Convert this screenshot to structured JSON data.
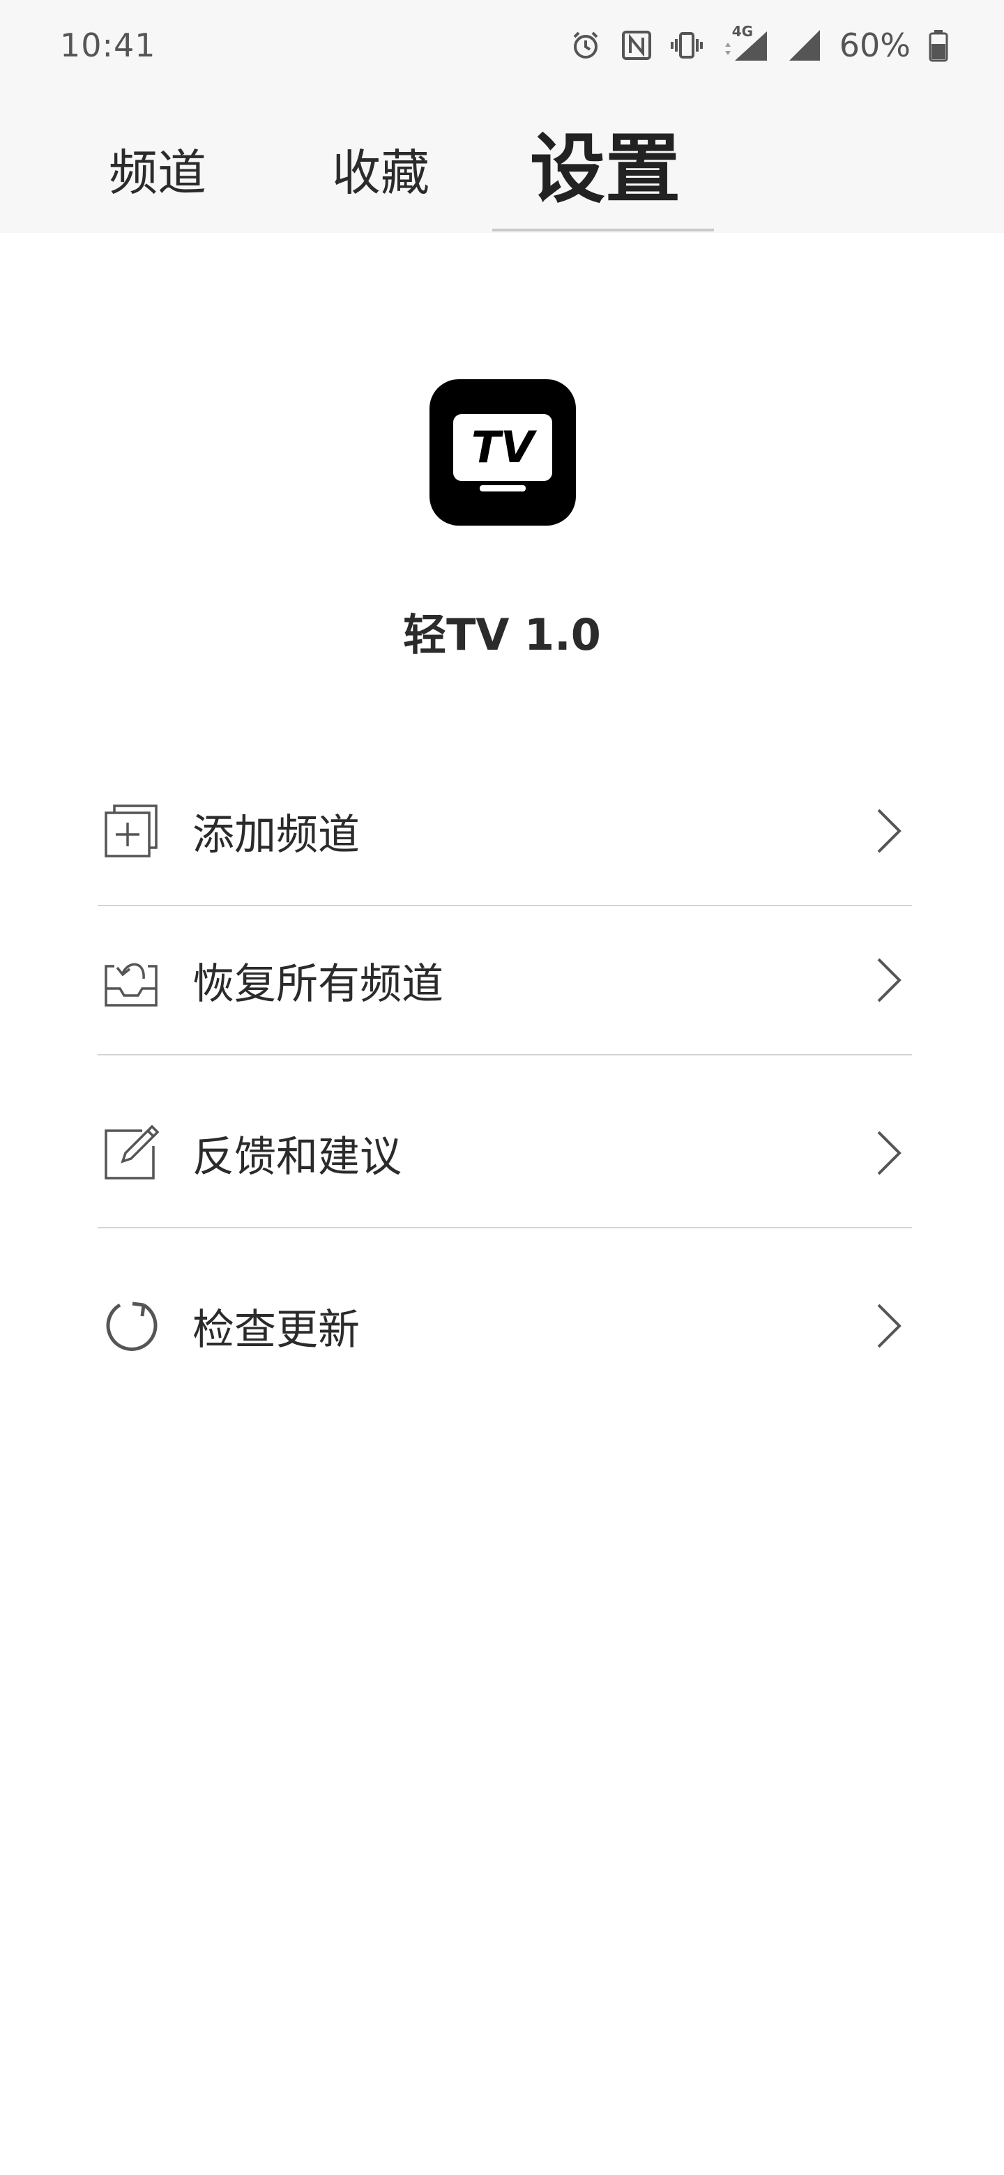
{
  "status_bar": {
    "time": "10:41",
    "network": "4G",
    "battery_percent": "60%",
    "icons": [
      "alarm-icon",
      "nfc-icon",
      "vibrate-icon",
      "data-arrows-icon",
      "signal-icon",
      "signal-icon",
      "battery-icon"
    ]
  },
  "tabs": [
    {
      "label": "频道",
      "active": false
    },
    {
      "label": "收藏",
      "active": false
    },
    {
      "label": "设置",
      "active": true
    }
  ],
  "app": {
    "logo_text": "TV",
    "name": "轻TV 1.0"
  },
  "menu": [
    {
      "label": "添加频道",
      "icon": "add-channel-icon"
    },
    {
      "label": "恢复所有频道",
      "icon": "restore-inbox-icon"
    },
    {
      "label": "反馈和建议",
      "icon": "edit-feedback-icon"
    },
    {
      "label": "检查更新",
      "icon": "refresh-icon"
    }
  ],
  "colors": {
    "header_bg": "#f7f7f7",
    "text": "#2b2b2b",
    "divider": "#d4d4d4",
    "logo_bg": "#000000"
  }
}
